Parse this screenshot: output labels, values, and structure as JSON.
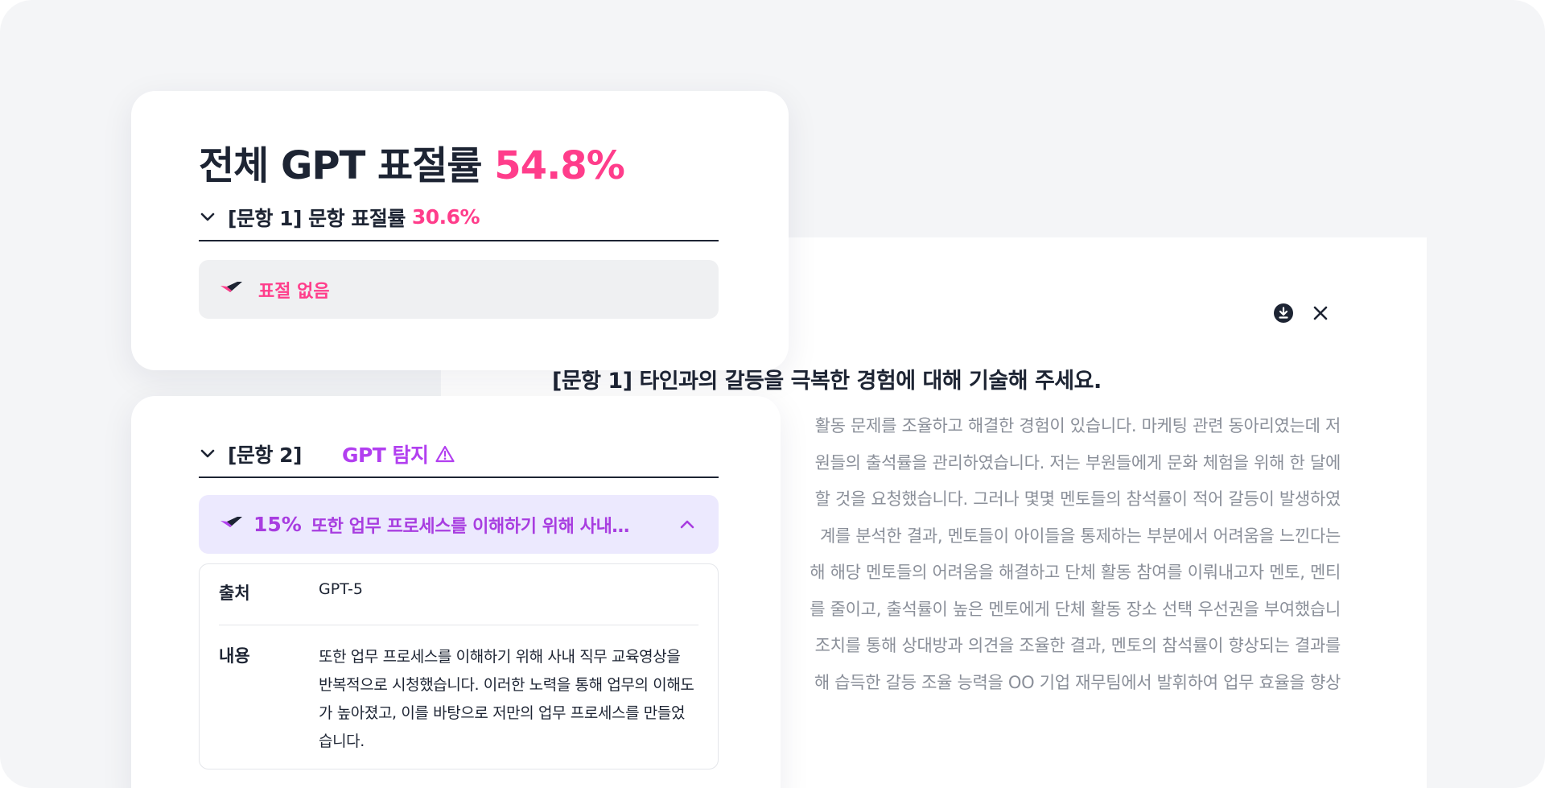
{
  "summary": {
    "title_prefix": "전체 GPT 표절률",
    "total_rate": "54.8%"
  },
  "question1": {
    "label": "[문항 1] 문항 표절률",
    "rate": "30.6%",
    "result": "표절 없음"
  },
  "question2": {
    "label": "[문항 2]",
    "detect_label": "GPT 탐지",
    "match": {
      "percent": "15%",
      "snippet": "또한 업무 프로세스를 이해하기 위해 사내…"
    },
    "source_key": "출처",
    "source_value": "GPT-5",
    "content_key": "내용",
    "content_value": "또한 업무 프로세스를 이해하기 위해 사내 직무 교육영상을 반복적으로 시청했습니다. 이러한 노력을 통해 업무의 이해도가 높아졌고, 이를 바탕으로 저만의 업무 프로세스를 만들었습니다."
  },
  "document": {
    "question": "[문항 1] 타인과의 갈등을 극복한 경험에 대해 기술해 주세요.",
    "lines": [
      "활동 문제를 조율하고 해결한 경험이 있습니다. 마케팅 관련 동아리였는데 저",
      "원들의 출석률을 관리하였습니다. 저는 부원들에게 문화 체험을 위해 한 달에",
      "할 것을 요청했습니다. 그러나 몇몇 멘토들의 참석률이 적어 갈등이 발생하였",
      "계를 분석한 결과, 멘토들이 아이들을 통제하는 부분에서 어려움을 느낀다는",
      "해 해당 멘토들의 어려움을 해결하고 단체 활동 참여를 이뤄내고자 멘토, 멘티",
      "를 줄이고, 출석률이 높은 멘토에게 단체 활동 장소 선택 우선권을 부여했습니",
      "조치를 통해 상대방과 의견을 조율한 결과, 멘토의 참석률이 향상되는 결과를",
      "해 습득한 갈등 조율 능력을 OO 기업 재무팀에서 발휘하여 업무 효율을 향상"
    ],
    "icons": {
      "download": "download-icon",
      "close": "close-icon"
    }
  },
  "colors": {
    "accent_pink": "#ff3d8b",
    "accent_purple": "#b23ff0",
    "text_dark": "#1d2433",
    "text_muted": "#8a8f99"
  }
}
